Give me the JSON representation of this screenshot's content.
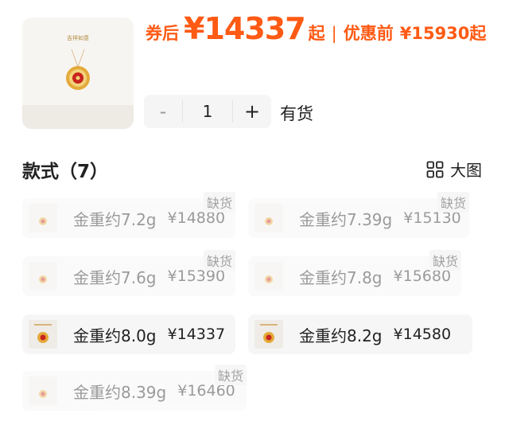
{
  "product": {
    "coupon_prefix": "券后",
    "coupon_price": "¥14337",
    "coupon_suffix": "起",
    "separator": "|",
    "pre_discount_label": "优惠前",
    "pre_discount_price": "¥15930起",
    "thumbnail_caption": "吉祥如意"
  },
  "quantity": {
    "minus": "-",
    "value": "1",
    "plus": "+"
  },
  "stock_status": "有货",
  "styles": {
    "title": "款式（7）",
    "view_toggle_label": "大图",
    "options": [
      {
        "label": "金重约7.2g",
        "price": "¥14880",
        "badge": "缺货"
      },
      {
        "label": "金重约7.39g",
        "price": "¥15130",
        "badge": "缺货"
      },
      {
        "label": "金重约7.6g",
        "price": "¥15390",
        "badge": "缺货"
      },
      {
        "label": "金重约7.8g",
        "price": "¥15680",
        "badge": "缺货"
      },
      {
        "label": "金重约8.0g",
        "price": "¥14337",
        "badge": ""
      },
      {
        "label": "金重约8.2g",
        "price": "¥14580",
        "badge": ""
      },
      {
        "label": "金重约8.39g",
        "price": "¥16460",
        "badge": "缺货"
      }
    ]
  },
  "colors": {
    "accent": "#ff5a14",
    "gold": "#e0a330",
    "ruby": "#c8241e"
  }
}
